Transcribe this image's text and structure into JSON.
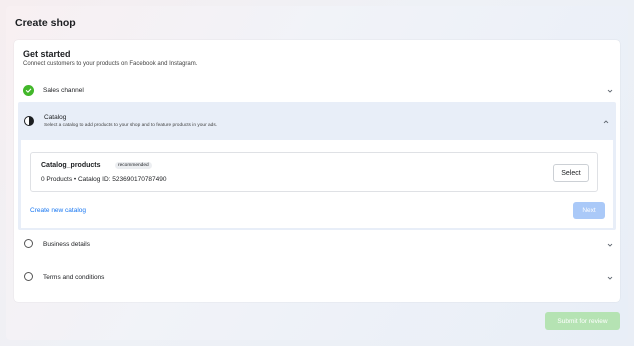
{
  "page": {
    "title": "Create shop"
  },
  "get_started": {
    "title": "Get started",
    "subtitle": "Connect customers to your products on Facebook and Instagram."
  },
  "steps": {
    "sales_channel": {
      "label": "Sales channel",
      "status": "complete"
    },
    "catalog": {
      "label": "Catalog",
      "description": "Select a catalog to add products to your shop and to feature products in your ads.",
      "status": "in-progress",
      "item": {
        "name": "Catalog_products",
        "badge": "recommended",
        "meta": "0 Products • Catalog ID: 523690170787490",
        "select_label": "Select"
      },
      "create_link": "Create new catalog",
      "next_label": "Next"
    },
    "business_details": {
      "label": "Business details",
      "status": "pending"
    },
    "terms": {
      "label": "Terms and conditions",
      "status": "pending"
    }
  },
  "footer": {
    "submit_label": "Submit for review"
  },
  "colors": {
    "accent": "#1877f2",
    "success": "#42b72a",
    "next_disabled": "#aac9f8",
    "submit_disabled": "#b5e3b3"
  },
  "icons": {
    "complete": "check-circle-icon",
    "in_progress": "half-circle-icon",
    "pending": "empty-circle-icon",
    "expand": "chevron-down-icon",
    "collapse": "chevron-up-icon"
  }
}
